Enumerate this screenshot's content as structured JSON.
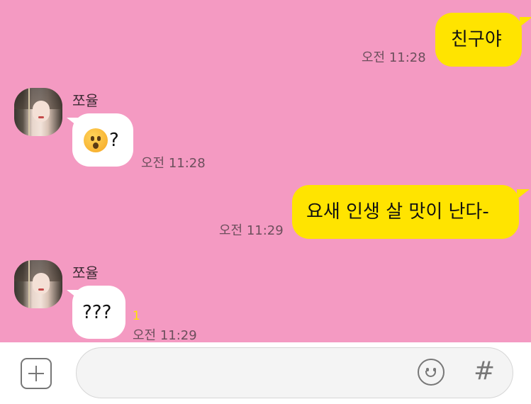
{
  "messages": [
    {
      "sender": "me",
      "text": "친구야",
      "time": "오전 11:28"
    },
    {
      "sender": "쪼율",
      "emoji": "hushed-face-emoji",
      "text": "?",
      "time": "오전 11:28"
    },
    {
      "sender": "me",
      "text": "요새 인생 살 맛이 난다-",
      "time": "오전 11:29"
    },
    {
      "sender": "쪼율",
      "text": "???",
      "time": "오전 11:29",
      "unread": "1"
    }
  ],
  "colors": {
    "chat_bg": "#f49ac2",
    "my_bubble": "#ffe400",
    "their_bubble": "#ffffff",
    "unread": "#ffe400"
  },
  "input_bar": {
    "left_icon": "plus-square-icon",
    "emoji_icon": "smiley-icon",
    "hash_icon": "#"
  }
}
